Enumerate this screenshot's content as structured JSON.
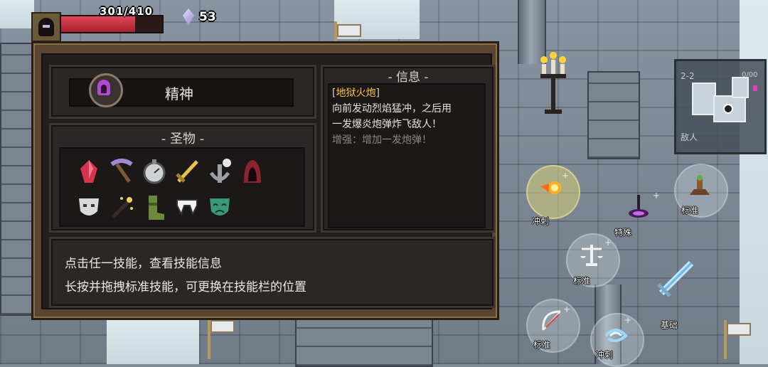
{
  "hud": {
    "hp_text": "301/410",
    "hp_fraction": 0.73,
    "gems": "53",
    "portrait_icon": "hooded-assassin-icon",
    "gem_icon": "crystal-gem-icon"
  },
  "panel": {
    "talent": {
      "label": "精神",
      "icon": "purple-hood-icon"
    },
    "relics": {
      "title": "- 圣物 -",
      "items": [
        {
          "icon": "red-crystal-icon",
          "color": "#d6334c"
        },
        {
          "icon": "pickaxe-icon",
          "color": "#a08ad8"
        },
        {
          "icon": "stopwatch-icon",
          "color": "#cfd2d4"
        },
        {
          "icon": "golden-sword-icon",
          "color": "#e6c24a"
        },
        {
          "icon": "anchor-skull-icon",
          "color": "#9aa0a6"
        },
        {
          "icon": "red-hood-icon",
          "color": "#8e2330"
        },
        {
          "icon": "white-mask-icon",
          "color": "#d9d9d9"
        },
        {
          "icon": "magic-wand-icon",
          "color": "#e8d55a"
        },
        {
          "icon": "green-boot-icon",
          "color": "#6c8b3a"
        },
        {
          "icon": "fangs-icon",
          "color": "#f2f2f2"
        },
        {
          "icon": "green-mask-icon",
          "color": "#3a9a78"
        }
      ]
    },
    "info": {
      "title": "- 信息 -",
      "bracket_open": "[",
      "name": "地狱火炮",
      "bracket_close": "]",
      "desc_line1": "向前发动烈焰猛冲，之后用",
      "desc_line2": "一发爆炎炮弹炸飞敌人！",
      "upgrade": "增强：增加一发炮弹！"
    },
    "hints": [
      "点击任一技能，查看技能信息",
      "长按并拖拽标准技能，可更换在技能栏的位置"
    ]
  },
  "minimap": {
    "level": "2-2",
    "label": "敌人",
    "distance": "0/00"
  },
  "skills": [
    {
      "label": "冲刺",
      "icon": "fireball-icon",
      "active": true
    },
    {
      "label": "标准",
      "icon": "totem-icon",
      "active": false
    },
    {
      "label": "特殊",
      "icon": "dark-trap-icon",
      "active": false
    },
    {
      "label": "标准",
      "icon": "scales-icon",
      "active": false
    },
    {
      "label": "基础",
      "icon": "ice-sword-icon",
      "active": false
    },
    {
      "label": "标准",
      "icon": "bow-icon",
      "active": false
    },
    {
      "label": "冲刺",
      "icon": "whirlwind-icon",
      "active": false
    }
  ],
  "colors": {
    "accent_gold": "#f5c63e",
    "hp_red": "#d83a4b",
    "panel_bg": "#231f1e"
  }
}
